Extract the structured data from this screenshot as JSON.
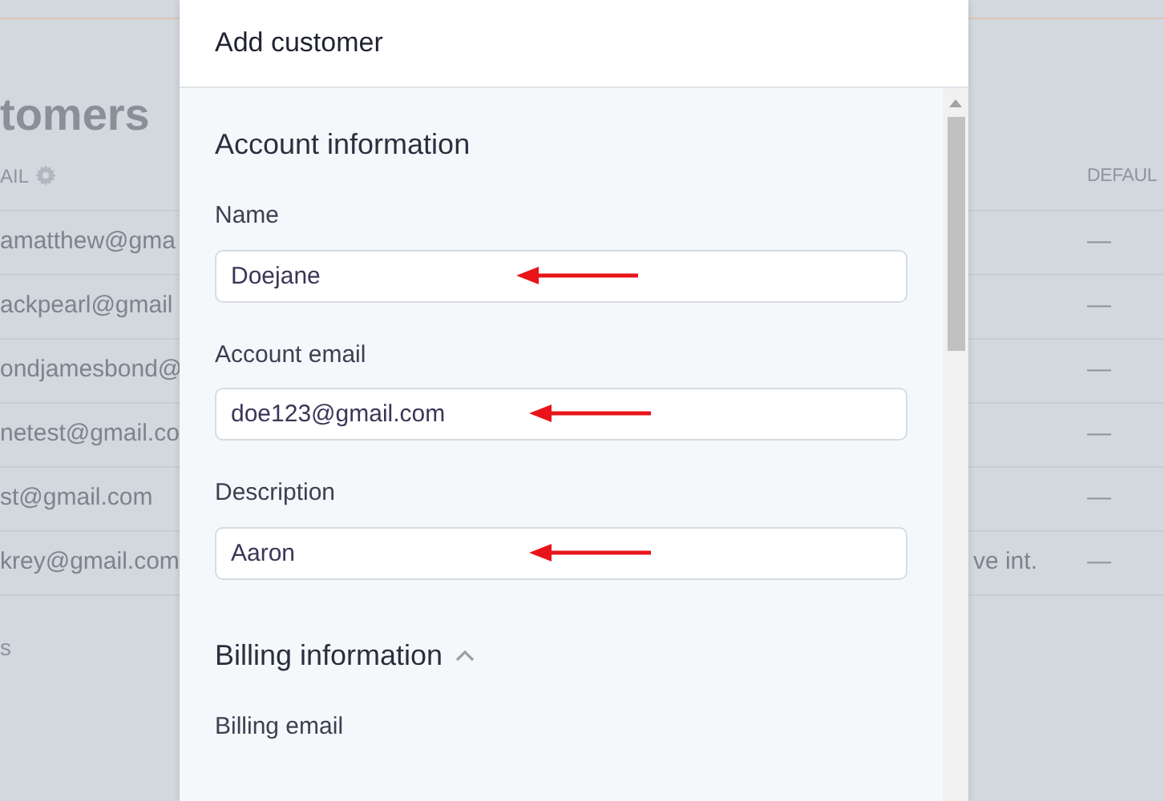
{
  "background": {
    "title": "tomers",
    "email_header": "AIL",
    "default_header": "DEFAUL",
    "rows": [
      {
        "email": "amatthew@gma",
        "default": "—"
      },
      {
        "email": "ackpearl@gmail",
        "default": "—"
      },
      {
        "email": "ondjamesbond@",
        "default": "—"
      },
      {
        "email": "netest@gmail.co",
        "default": "—"
      },
      {
        "email": "st@gmail.com",
        "default": "—"
      },
      {
        "email": "krey@gmail.com",
        "note": "ve int.",
        "default": "—"
      }
    ],
    "footer": "s"
  },
  "modal": {
    "title": "Add customer",
    "sections": [
      {
        "title": "Account information",
        "fields": [
          {
            "label": "Name",
            "value": "Doejane"
          },
          {
            "label": "Account email",
            "value": "doe123@gmail.com"
          },
          {
            "label": "Description",
            "value": "Aaron"
          }
        ]
      },
      {
        "title": "Billing information",
        "expanded": true,
        "fields": [
          {
            "label": "Billing email"
          }
        ]
      }
    ]
  }
}
